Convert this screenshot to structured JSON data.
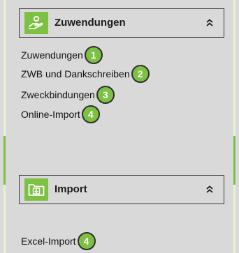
{
  "sections": [
    {
      "title": "Zuwendungen",
      "icon": "hand-donation-icon",
      "toggle_icon": "chevron-double-up-icon",
      "items": [
        {
          "label": "Zuwendungen",
          "badge": "1"
        },
        {
          "label": "ZWB und Dankschreiben",
          "badge": "2"
        },
        {
          "label": "Zweckbindungen",
          "badge": "3"
        },
        {
          "label": "Online-Import",
          "badge": "4"
        }
      ]
    },
    {
      "title": "Import",
      "icon": "folder-download-icon",
      "toggle_icon": "chevron-double-up-icon",
      "items": [
        {
          "label": "Excel-Import",
          "badge": "4"
        }
      ]
    }
  ],
  "colors": {
    "accent": "#7cc142",
    "panel_background": "#d9d9d9",
    "border": "#3a3a3a",
    "text": "#111111"
  }
}
